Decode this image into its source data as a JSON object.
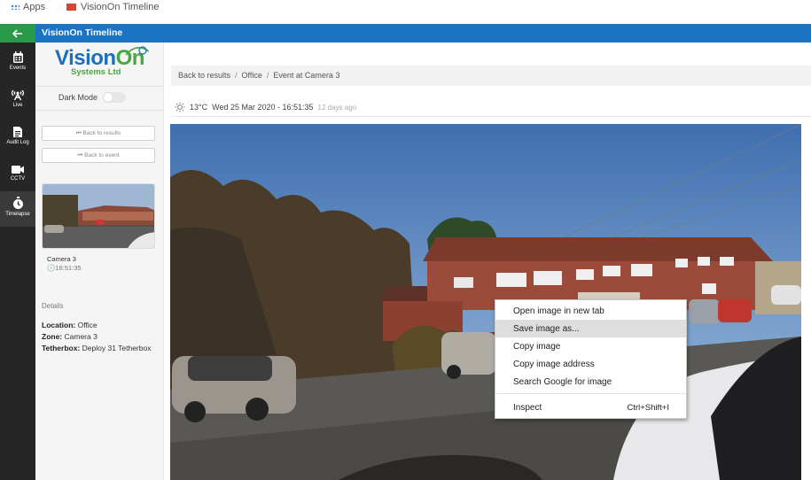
{
  "browser": {
    "apps_label": "Apps",
    "bookmark_label": "VisionOn Timeline"
  },
  "topbar": {
    "back_icon": "arrow-left-icon",
    "title": "VisionOn Timeline"
  },
  "rail": [
    {
      "label": "Events",
      "icon": "calendar-icon"
    },
    {
      "label": "Live",
      "icon": "broadcast-icon"
    },
    {
      "label": "Audit Log",
      "icon": "document-icon"
    },
    {
      "label": "CCTV",
      "icon": "video-camera-icon"
    },
    {
      "label": "Timelapse",
      "icon": "stopwatch-icon",
      "active": true
    }
  ],
  "panel": {
    "logo_brand_1": "Vision",
    "logo_brand_2": "On",
    "logo_sub": "Systems Ltd",
    "dark_mode_label": "Dark Mode",
    "dark_mode_on": false,
    "back_to_results": "⏮ Back to results",
    "back_to_event": "⏮ Back to event",
    "camera_name": "Camera 3",
    "camera_time": "🕓16:51:35",
    "details_heading": "Details",
    "details": [
      {
        "key": "Location:",
        "value": " Office"
      },
      {
        "key": "Zone:",
        "value": " Camera 3"
      },
      {
        "key": "Tetherbox:",
        "value": " Deploy 31 Tetherbox"
      }
    ]
  },
  "breadcrumb": {
    "items": [
      "Back to results",
      "Office",
      "Event at Camera 3"
    ],
    "separator": "/"
  },
  "info": {
    "weather_icon": "sun-icon",
    "temperature": "13°C",
    "datetime": "Wed 25 Mar 2020 - 16:51:35",
    "ago": "12 days ago"
  },
  "context_menu": {
    "items": [
      {
        "label": "Open image in new tab",
        "shortcut": ""
      },
      {
        "label": "Save image as...",
        "shortcut": "",
        "highlighted": true
      },
      {
        "label": "Copy image",
        "shortcut": ""
      },
      {
        "label": "Copy image address",
        "shortcut": ""
      },
      {
        "label": "Search Google for image",
        "shortcut": ""
      },
      {
        "label": "Inspect",
        "shortcut": "Ctrl+Shift+I"
      }
    ]
  },
  "colors": {
    "topbar": "#1b73c4",
    "back_button": "#2a9a4a",
    "rail": "#262626",
    "brand_blue": "#1c6fb8",
    "brand_green": "#4aa543"
  }
}
